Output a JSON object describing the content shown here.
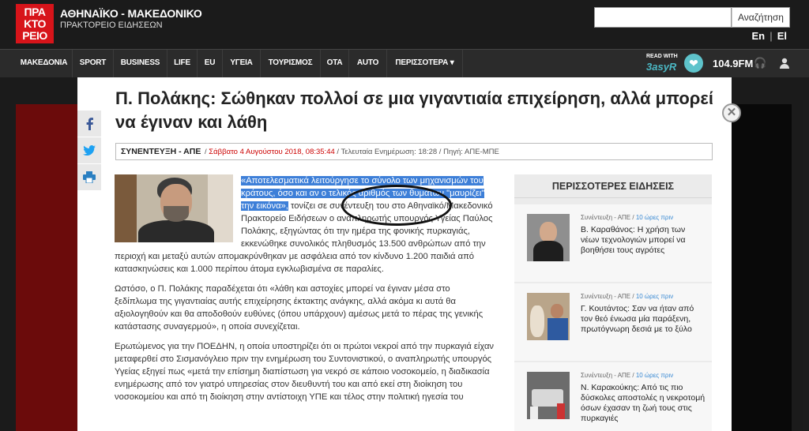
{
  "header": {
    "logo": [
      "ΠΡΑ",
      "ΚΤΟ",
      "ΡΕΙΟ"
    ],
    "brand_line1": "ΑΘΗΝΑΪΚΟ - ΜΑΚΕΔΟΝΙΚΟ",
    "brand_line2": "ΠΡΑΚΤΟΡΕΙΟ ΕΙΔΗΣΕΩΝ",
    "search_placeholder": "",
    "search_button": "Αναζήτηση",
    "lang_en": "En",
    "lang_sep": "|",
    "lang_el": "El"
  },
  "nav": {
    "items": [
      "ΜΑΚΕΔΟΝΙΑ",
      "SPORT",
      "BUSINESS",
      "LIFE",
      "EU",
      "ΥΓΕΙΑ",
      "ΤΟΥΡΙΣΜΟΣ",
      "ΟΤΑ",
      "AUTO",
      "ΠΕΡΙΣΣΟΤΕΡΑ"
    ],
    "read_with": "READ WITH",
    "easyr": "3asyR",
    "radio": "104.9FM"
  },
  "article": {
    "title": "Π. Πολάκης: Σώθηκαν πολλοί σε μια γιγαντιαία επιχείρηση, αλλά μπορεί να έγιναν και λάθη",
    "category": "ΣΥΝΕΝΤΕΥΞΗ - ΑΠΕ",
    "date": "Σάββατο 4 Αυγούστου 2018, 08:35:44",
    "updated": "Τελευταία Ενημέρωση: 18:28",
    "source": "Πηγή: ΑΠΕ-ΜΠΕ",
    "meta_sep": " / ",
    "p1_highlight": "«Αποτελεσματικά λειτούργησε το σύνολο των μηχανισμών του κράτους, όσο και αν ο τελικός αριθμός των θυμάτων \"μαυρίζει\" την εικόνα»,",
    "p1_rest": " τονίζει σε συνέντευξη του στο Αθηναϊκό/Μακεδονικό Πρακτορείο Ειδήσεων ο αναπληρωτής υπουργός Υγείας Παύλος Πολάκης, εξηγώντας ότι την ημέρα της φονικής πυρκαγιάς, εκκενώθηκε συνολικός πληθυσμός 13.500 ανθρώπων από την περιοχή και μεταξύ αυτών απομακρύνθηκαν με ασφάλεια από τον κίνδυνο 1.200 παιδιά από κατασκηνώσεις και 1.000 περίπου άτομα εγκλωβισμένα σε παραλίες.",
    "p2": "Ωστόσο, ο Π. Πολάκης παραδέχεται ότι «λάθη και αστοχίες μπορεί να έγιναν μέσα στο ξεδίπλωμα της γιγαντιαίας αυτής επιχείρησης έκτακτης ανάγκης, αλλά ακόμα κι αυτά θα αξιολογηθούν και θα αποδοθούν ευθύνες (όπου υπάρχουν) αμέσως μετά το πέρας της γενικής κατάστασης συναγερμού», η οποία συνεχίζεται.",
    "p3": "Ερωτώμενος για την ΠΟΕΔΗΝ, η οποία υποστηρίζει ότι οι πρώτοι νεκροί από την πυρκαγιά είχαν μεταφερθεί στο Σισμανόγλειο πριν την ενημέρωση του Συντονιστικού, ο αναπληρωτής υπουργός Υγείας εξηγεί πως «μετά την επίσημη διαπίστωση για νεκρό σε κάποιο νοσοκομείο, η διαδικασία ενημέρωσης από τον γιατρό υπηρεσίας στον διευθυντή του και από εκεί στη διοίκηση του νοσοκομείου και από τη διοίκηση στην αντίστοιχη ΥΠΕ και τέλος στην πολιτική ηγεσία του"
  },
  "sidebar": {
    "heading": "ΠΕΡΙΣΣΟΤΕΡΕΣ ΕΙΔΗΣΕΙΣ",
    "items": [
      {
        "kicker": "Συνέντευξη - ΑΠΕ / ",
        "time": "10 ώρες πριν",
        "headline": "Β. Καραθάνος: Η χρήση των νέων τεχνολογιών μπορεί να βοηθήσει τους αγρότες"
      },
      {
        "kicker": "Συνέντευξη - ΑΠΕ / ",
        "time": "10 ώρες πριν",
        "headline": "Γ. Κουτάντος: Σαν να ήταν από τον θεό ένιωσα μία παράξενη, πρωτόγνωρη δεσιά με το ξύλο"
      },
      {
        "kicker": "Συνέντευξη - ΑΠΕ / ",
        "time": "10 ώρες πριν",
        "headline": "Ν. Καρακούκης: Από τις πιο δύσκολες αποστολές η νεκροτομή όσων έχασαν τη ζωή τους στις πυρκαγιές"
      }
    ]
  },
  "colors": {
    "brand_red": "#d7141a",
    "highlight": "#3d7fd8",
    "link_blue": "#3a8ad3"
  },
  "icons": [
    "facebook-icon",
    "twitter-icon",
    "print-icon",
    "close-icon",
    "user-icon",
    "headphones-icon",
    "heart-icon"
  ]
}
